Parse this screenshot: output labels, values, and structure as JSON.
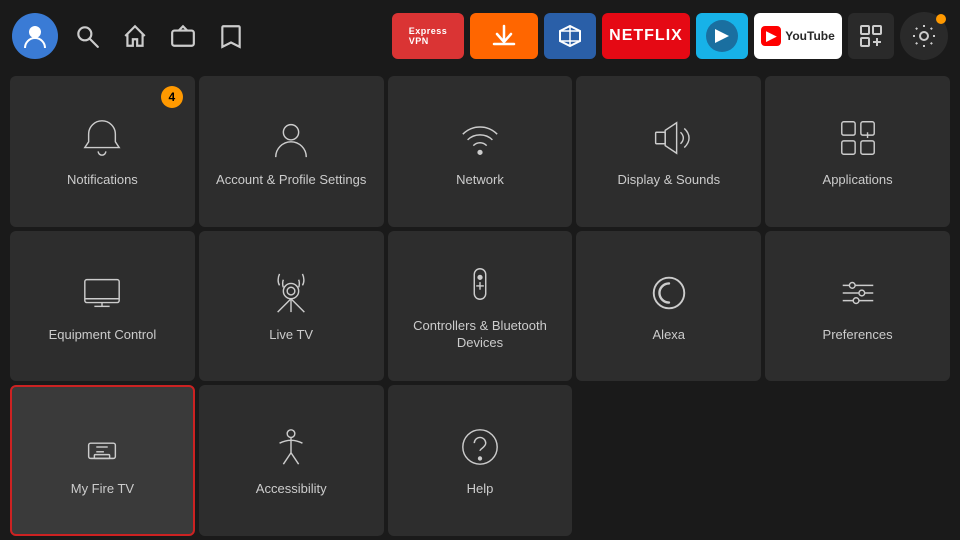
{
  "topbar": {
    "nav_items": [
      {
        "name": "search-icon",
        "label": "Search"
      },
      {
        "name": "home-icon",
        "label": "Home"
      },
      {
        "name": "live-tv-icon",
        "label": "Live TV"
      },
      {
        "name": "watchlist-icon",
        "label": "Watchlist"
      }
    ],
    "apps": [
      {
        "name": "expressvpn-btn",
        "label": "ExpressVPN",
        "color": "#da3434"
      },
      {
        "name": "downloader-btn",
        "label": "Downloader",
        "color": "#ff6600"
      },
      {
        "name": "generic-btn",
        "label": "App",
        "color": "#2a5fa8"
      },
      {
        "name": "netflix-btn",
        "label": "NETFLIX",
        "color": "#e50914"
      },
      {
        "name": "kodi-btn",
        "label": "KODI",
        "color": "#17b2e8"
      },
      {
        "name": "youtube-btn",
        "label": "YouTube",
        "color": "#ffffff"
      }
    ]
  },
  "grid": {
    "tiles": [
      {
        "id": "notifications",
        "label": "Notifications",
        "icon": "bell",
        "badge": "4",
        "selected": false
      },
      {
        "id": "account-profile",
        "label": "Account & Profile Settings",
        "icon": "person",
        "badge": null,
        "selected": false
      },
      {
        "id": "network",
        "label": "Network",
        "icon": "wifi",
        "badge": null,
        "selected": false
      },
      {
        "id": "display-sounds",
        "label": "Display & Sounds",
        "icon": "speaker",
        "badge": null,
        "selected": false
      },
      {
        "id": "applications",
        "label": "Applications",
        "icon": "apps",
        "badge": null,
        "selected": false
      },
      {
        "id": "equipment-control",
        "label": "Equipment Control",
        "icon": "monitor",
        "badge": null,
        "selected": false
      },
      {
        "id": "live-tv",
        "label": "Live TV",
        "icon": "antenna",
        "badge": null,
        "selected": false
      },
      {
        "id": "controllers-bluetooth",
        "label": "Controllers & Bluetooth Devices",
        "icon": "remote",
        "badge": null,
        "selected": false
      },
      {
        "id": "alexa",
        "label": "Alexa",
        "icon": "alexa",
        "badge": null,
        "selected": false
      },
      {
        "id": "preferences",
        "label": "Preferences",
        "icon": "sliders",
        "badge": null,
        "selected": false
      },
      {
        "id": "my-fire-tv",
        "label": "My Fire TV",
        "icon": "firetv",
        "badge": null,
        "selected": true
      },
      {
        "id": "accessibility",
        "label": "Accessibility",
        "icon": "accessibility",
        "badge": null,
        "selected": false
      },
      {
        "id": "help",
        "label": "Help",
        "icon": "help",
        "badge": null,
        "selected": false
      }
    ]
  }
}
